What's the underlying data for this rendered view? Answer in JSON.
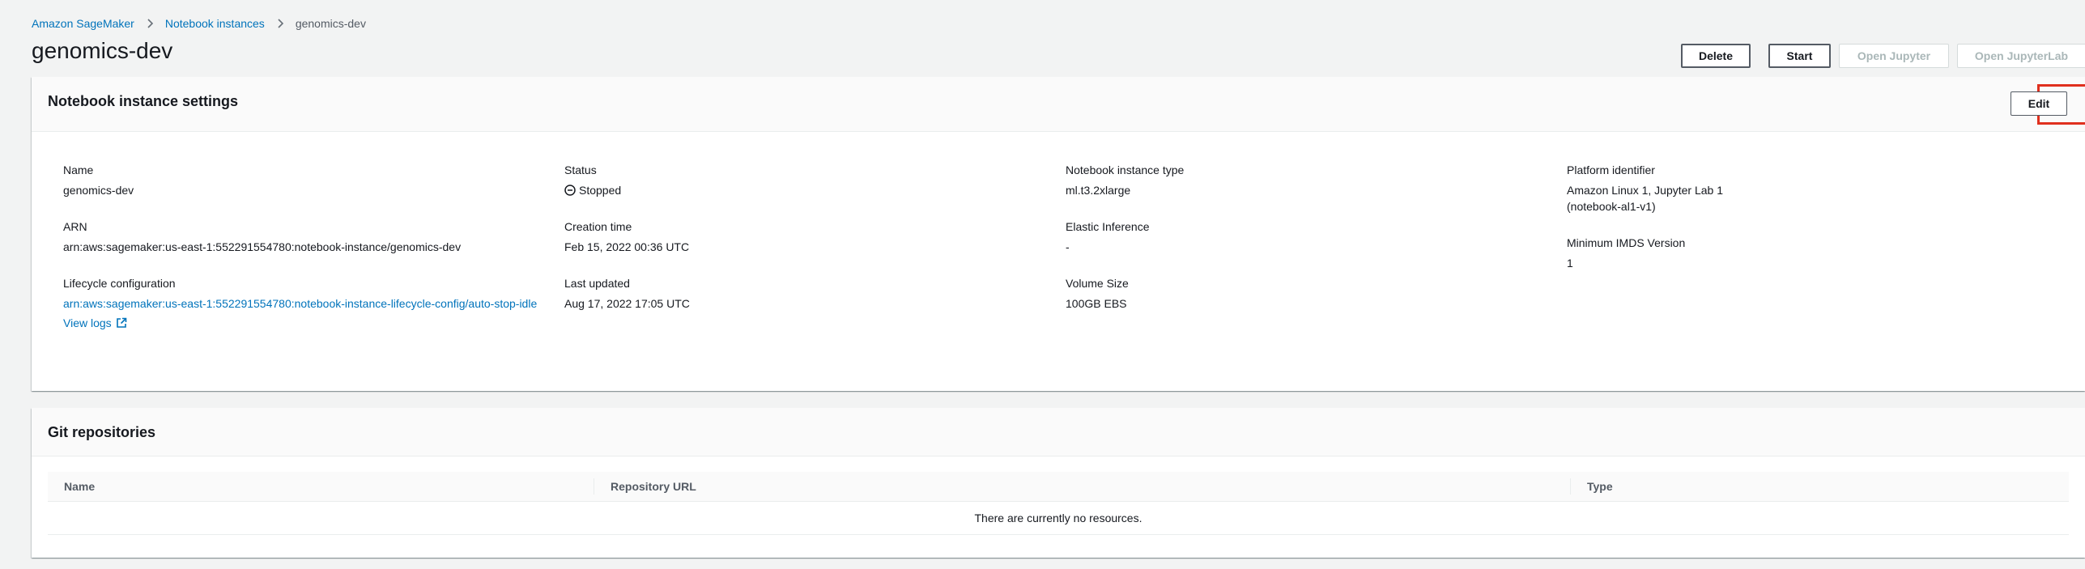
{
  "breadcrumb": {
    "items": [
      {
        "label": "Amazon SageMaker"
      },
      {
        "label": "Notebook instances"
      },
      {
        "label": "genomics-dev"
      }
    ]
  },
  "page": {
    "title": "genomics-dev"
  },
  "actions": {
    "delete_label": "Delete",
    "start_label": "Start",
    "open_jupyter_label": "Open Jupyter",
    "open_jupyterlab_label": "Open JupyterLab"
  },
  "settings": {
    "title": "Notebook instance settings",
    "edit_label": "Edit",
    "name": {
      "label": "Name",
      "value": "genomics-dev"
    },
    "arn": {
      "label": "ARN",
      "value": "arn:aws:sagemaker:us-east-1:552291554780:notebook-instance/genomics-dev"
    },
    "lifecycle": {
      "label": "Lifecycle configuration",
      "value": "arn:aws:sagemaker:us-east-1:552291554780:notebook-instance-lifecycle-config/auto-stop-idle",
      "view_logs": "View logs"
    },
    "status": {
      "label": "Status",
      "value": "Stopped",
      "icon": "stopped-icon"
    },
    "creation_time": {
      "label": "Creation time",
      "value": "Feb 15, 2022 00:36 UTC"
    },
    "last_updated": {
      "label": "Last updated",
      "value": "Aug 17, 2022 17:05 UTC"
    },
    "instance_type": {
      "label": "Notebook instance type",
      "value": "ml.t3.2xlarge"
    },
    "elastic_inference": {
      "label": "Elastic Inference",
      "value": "-"
    },
    "volume_size": {
      "label": "Volume Size",
      "value": "100GB EBS"
    },
    "platform": {
      "label": "Platform identifier",
      "value_line1": "Amazon Linux 1, Jupyter Lab 1",
      "value_line2": "(notebook-al1-v1)"
    },
    "imds": {
      "label": "Minimum IMDS Version",
      "value": "1"
    }
  },
  "git": {
    "title": "Git repositories",
    "columns": [
      "Name",
      "Repository URL",
      "Type"
    ],
    "empty_message": "There are currently no resources."
  },
  "colors": {
    "link": "#0073bb",
    "highlight": "#e0301e",
    "background": "#f2f3f3"
  }
}
